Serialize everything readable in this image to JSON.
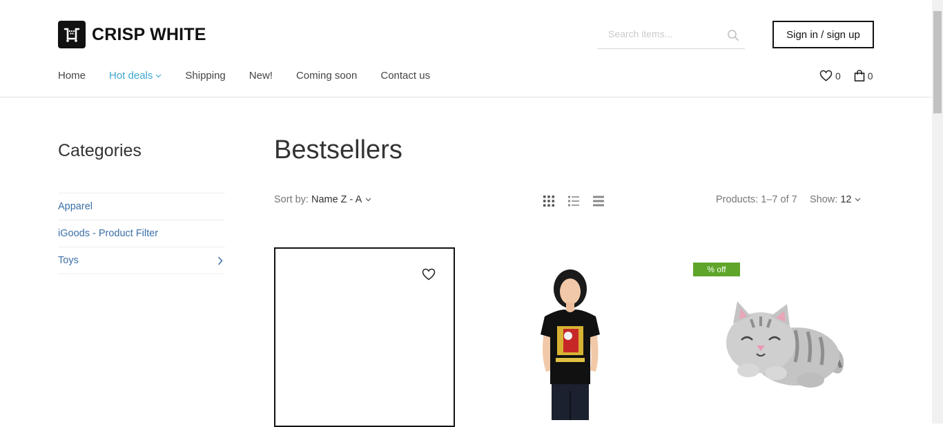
{
  "brand": {
    "name": "CRISP WHITE"
  },
  "search": {
    "placeholder": "Search items..."
  },
  "account": {
    "sign_in_label": "Sign in / sign up"
  },
  "nav": {
    "items": [
      {
        "label": "Home"
      },
      {
        "label": "Hot deals"
      },
      {
        "label": "Shipping"
      },
      {
        "label": "New!"
      },
      {
        "label": "Coming soon"
      },
      {
        "label": "Contact us"
      }
    ]
  },
  "header_counts": {
    "wishlist": "0",
    "cart": "0"
  },
  "sidebar": {
    "title": "Categories",
    "items": [
      {
        "label": "Apparel"
      },
      {
        "label": "iGoods - Product Filter"
      },
      {
        "label": "Toys"
      }
    ]
  },
  "main": {
    "title": "Bestsellers",
    "sort_label": "Sort by:",
    "sort_value": "Name Z - A",
    "products_count": "Products: 1–7 of 7",
    "show_label": "Show:",
    "show_value": "12"
  },
  "products": [
    {
      "badge": ""
    },
    {
      "badge": ""
    },
    {
      "badge": "% off"
    }
  ],
  "colors": {
    "accent": "#3ea7d0",
    "link": "#3b6fa6",
    "badge": "#5ea52a"
  }
}
